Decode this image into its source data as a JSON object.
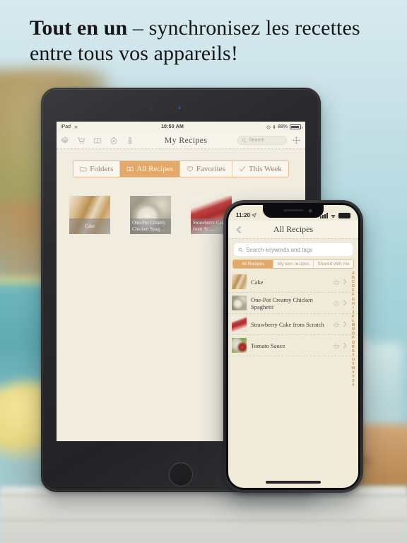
{
  "headline": {
    "strong": "Tout en un",
    "rest": " – synchronisez les recettes entre tous vos appareils!"
  },
  "colors": {
    "accent_orange": "#e3a96a",
    "index_orange": "#c98b3f",
    "screen_cream": "#f0ead9",
    "bezel_dark": "#2b2b2d",
    "background_teal": "#a9d5dc"
  },
  "ipad": {
    "status": {
      "device": "iPad",
      "wifi_icon": "wifi-icon",
      "time": "10:50 AM",
      "rotation_lock_icon": "rotation-lock-icon",
      "bluetooth_icon": "bluetooth-icon",
      "battery_percent": "88%",
      "battery_icon": "battery-icon"
    },
    "toolbar": {
      "icons": [
        {
          "name": "gear-icon",
          "label": "Settings"
        },
        {
          "name": "shopping-cart-icon",
          "label": "Shopping List"
        },
        {
          "name": "menu-planner-icon",
          "label": "Menu Planner"
        },
        {
          "name": "timer-icon",
          "label": "Timer"
        },
        {
          "name": "thermometer-icon",
          "label": "Conversions"
        }
      ],
      "title": "My Recipes",
      "search_placeholder": "Search",
      "search_value": "",
      "search_icon": "search-icon",
      "add_icon": "plus-icon"
    },
    "segments": [
      {
        "label": "Folders",
        "icon": "folder-icon",
        "selected": false
      },
      {
        "label": "All Recipes",
        "icon": "cards-icon",
        "selected": true
      },
      {
        "label": "Favorites",
        "icon": "heart-icon",
        "selected": false
      },
      {
        "label": "This Week",
        "icon": "checkmark-icon",
        "selected": false
      }
    ],
    "recipe_cards": [
      {
        "title": "Cake",
        "thumb": "cake-photo"
      },
      {
        "title": "One-Pot Creamy Chicken Spag…",
        "thumb": "pasta-photo"
      },
      {
        "title": "Strawberry Cake from Sc…",
        "thumb": "strawberry-cake-photo"
      }
    ]
  },
  "iphone": {
    "status": {
      "time": "11:20",
      "location_icon": "location-arrow-icon",
      "signal_icon": "cellular-signal-icon",
      "wifi_icon": "wifi-icon",
      "battery_icon": "battery-icon"
    },
    "nav": {
      "back_icon": "back-chevron-icon",
      "title": "All Recipes"
    },
    "search": {
      "placeholder": "Search keywords and tags",
      "value": "",
      "icon": "search-icon"
    },
    "segments": [
      {
        "label": "All Recipes",
        "selected": true
      },
      {
        "label": "My own recipes",
        "selected": false
      },
      {
        "label": "Shared with me",
        "selected": false
      }
    ],
    "rows": [
      {
        "title": "Cake",
        "thumb": "cake-photo",
        "icon": "bowl-icon",
        "chevron": "chevron-right-icon"
      },
      {
        "title": "One-Pot Creamy Chicken Spaghetti",
        "thumb": "pasta-photo",
        "icon": "bowl-icon",
        "chevron": "chevron-right-icon"
      },
      {
        "title": "Strawberry Cake from Scratch",
        "thumb": "strawberry-cake-photo",
        "icon": "bowl-icon",
        "chevron": "chevron-right-icon"
      },
      {
        "title": "Tomato Sauce",
        "thumb": "tomato-sauce-photo",
        "icon": "bowl-icon",
        "chevron": "chevron-right-icon"
      }
    ],
    "index": "ABCDEFGHIJKLMNOPQRSTUVWXYZ#",
    "home_indicator": "home-indicator"
  }
}
